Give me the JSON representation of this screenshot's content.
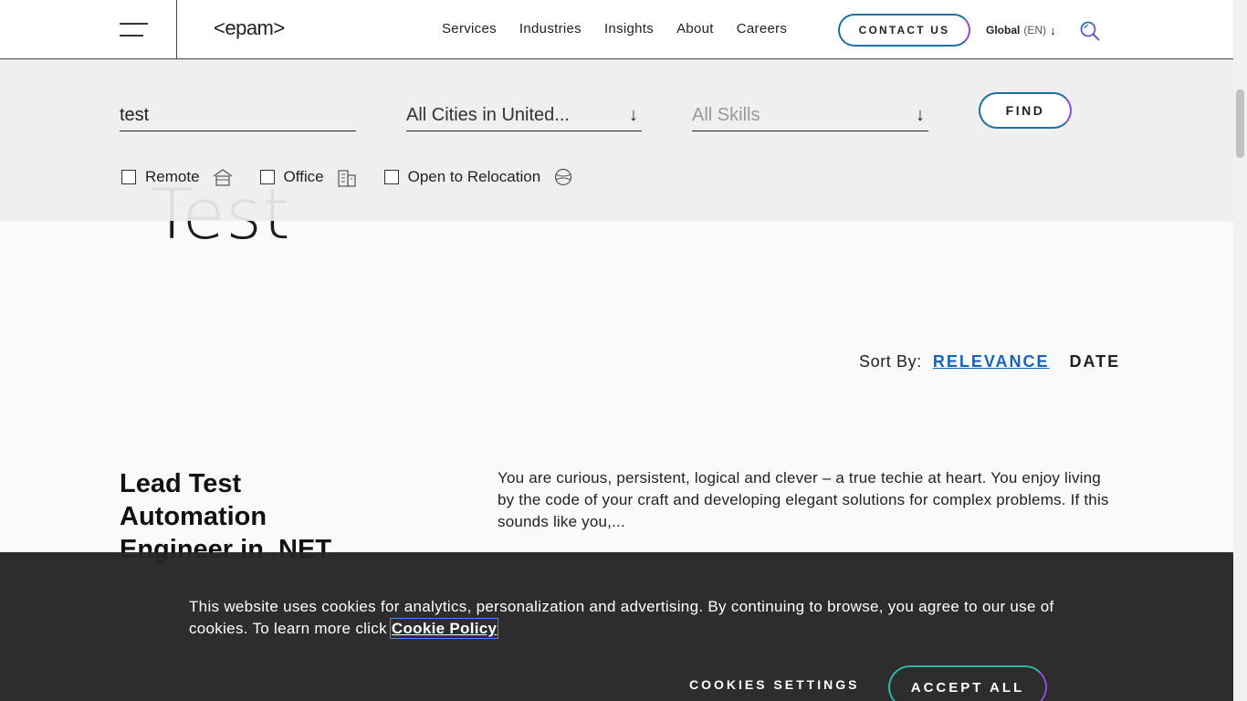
{
  "header": {
    "logo": "<epam>",
    "nav": [
      "Services",
      "Industries",
      "Insights",
      "About",
      "Careers"
    ],
    "contact_label": "CONTACT US",
    "locale_region": "Global",
    "locale_lang": "(EN)"
  },
  "hero": {
    "title": "Test"
  },
  "search": {
    "keyword_value": "test",
    "city_value": "All Cities in United...",
    "skills_placeholder": "All Skills",
    "find_label": "FIND",
    "filters": [
      {
        "label": "Remote",
        "icon": "home-icon",
        "checked": false
      },
      {
        "label": "Office",
        "icon": "building-icon",
        "checked": false
      },
      {
        "label": "Open to Relocation",
        "icon": "globe-icon",
        "checked": false
      }
    ]
  },
  "sort": {
    "label": "Sort By:",
    "relevance": "RELEVANCE",
    "date": "DATE"
  },
  "job": {
    "title": "Lead Test Automation Engineer in .NET",
    "description": "You are curious, persistent, logical and clever – a true techie at heart. You enjoy living by the code of your craft and developing elegant solutions for complex problems. If this sounds like you,..."
  },
  "cookie": {
    "text": "This website uses cookies for analytics, personalization and advertising. By continuing to browse, you agree to our use of cookies. To learn more click ",
    "link": "Cookie Policy",
    "settings_label": "COOKIES SETTINGS",
    "accept_label": "ACCEPT ALL"
  },
  "colors": {
    "accent_blue": "#1565c0",
    "gradient_start": "#1d6fa5",
    "gradient_end": "#8a4ed1",
    "teal": "#2bb8a2",
    "banner_bg": "#262626"
  }
}
